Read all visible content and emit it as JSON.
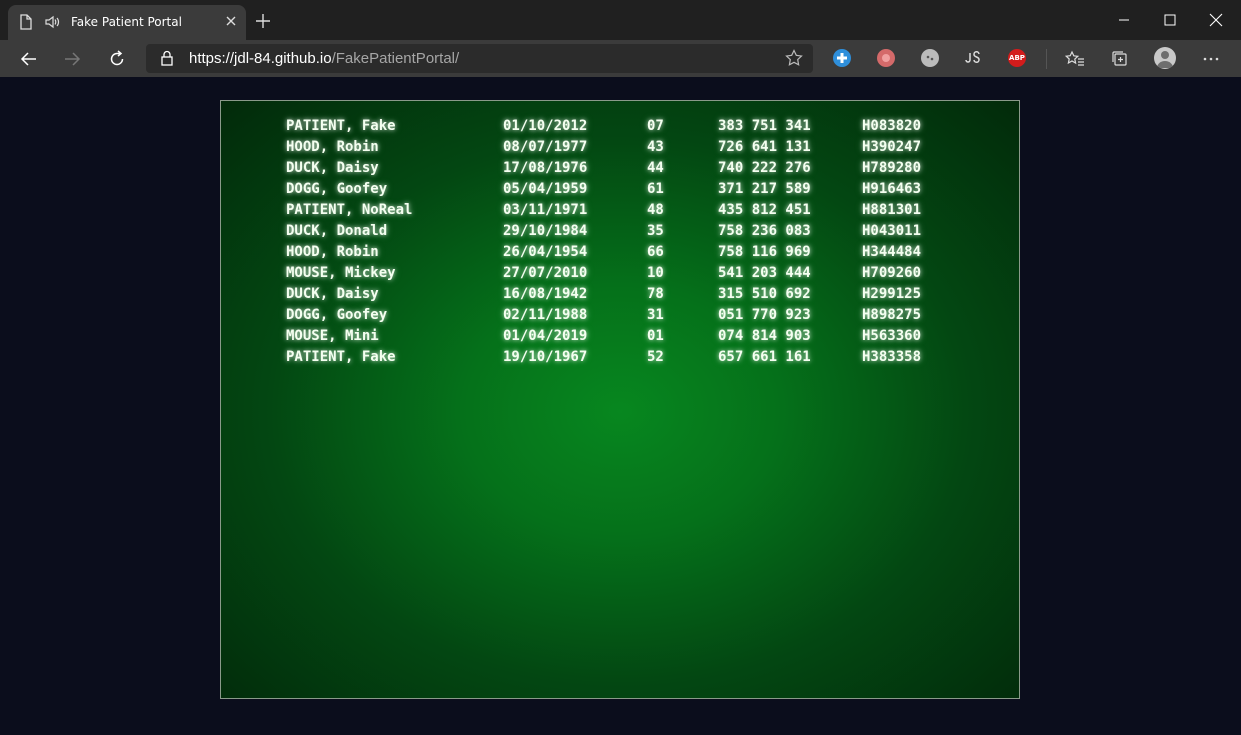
{
  "browser": {
    "tab_title": "Fake Patient Portal",
    "url_host": "https://jdl-84.github.io",
    "url_path": "/FakePatientPortal/",
    "extensions": [
      {
        "icon": "plus-extension-icon",
        "color": "#2f8fdb"
      },
      {
        "icon": "brain-extension-icon",
        "color": "#d46a6a"
      },
      {
        "icon": "cookie-extension-icon",
        "color": "#bbbbbb"
      },
      {
        "icon": "js-extension-icon",
        "color": "#dddddd"
      },
      {
        "icon": "adblock-plus-icon",
        "label": "ABP",
        "color": "#d31c1c"
      }
    ]
  },
  "patients": [
    {
      "name": "PATIENT, Fake",
      "dob": "01/10/2012",
      "age": "07",
      "nhs": "383 751 341",
      "hosp": "H083820"
    },
    {
      "name": "HOOD, Robin",
      "dob": "08/07/1977",
      "age": "43",
      "nhs": "726 641 131",
      "hosp": "H390247"
    },
    {
      "name": "DUCK, Daisy",
      "dob": "17/08/1976",
      "age": "44",
      "nhs": "740 222 276",
      "hosp": "H789280"
    },
    {
      "name": "DOGG, Goofey",
      "dob": "05/04/1959",
      "age": "61",
      "nhs": "371 217 589",
      "hosp": "H916463"
    },
    {
      "name": "PATIENT, NoReal",
      "dob": "03/11/1971",
      "age": "48",
      "nhs": "435 812 451",
      "hosp": "H881301"
    },
    {
      "name": "DUCK, Donald",
      "dob": "29/10/1984",
      "age": "35",
      "nhs": "758 236 083",
      "hosp": "H043011"
    },
    {
      "name": "HOOD, Robin",
      "dob": "26/04/1954",
      "age": "66",
      "nhs": "758 116 969",
      "hosp": "H344484"
    },
    {
      "name": "MOUSE, Mickey",
      "dob": "27/07/2010",
      "age": "10",
      "nhs": "541 203 444",
      "hosp": "H709260"
    },
    {
      "name": "DUCK, Daisy",
      "dob": "16/08/1942",
      "age": "78",
      "nhs": "315 510 692",
      "hosp": "H299125"
    },
    {
      "name": "DOGG, Goofey",
      "dob": "02/11/1988",
      "age": "31",
      "nhs": "051 770 923",
      "hosp": "H898275"
    },
    {
      "name": "MOUSE, Mini",
      "dob": "01/04/2019",
      "age": "01",
      "nhs": "074 814 903",
      "hosp": "H563360"
    },
    {
      "name": "PATIENT, Fake",
      "dob": "19/10/1967",
      "age": "52",
      "nhs": "657 661 161",
      "hosp": "H383358"
    }
  ]
}
